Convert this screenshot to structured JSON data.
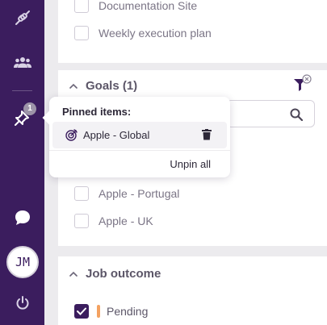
{
  "sidebar": {
    "pinned_count": "1",
    "avatar_initials": "JM",
    "icons": [
      "integrations-icon",
      "team-icon",
      "pin-icon",
      "chat-icon",
      "power-icon"
    ]
  },
  "tasks": {
    "items": [
      {
        "label": "Documentation Site",
        "checked": false
      },
      {
        "label": "Weekly execution plan",
        "checked": false
      }
    ]
  },
  "goals": {
    "title": "Goals (1)",
    "items": [
      {
        "label": "Apple - Portugal",
        "checked": false
      },
      {
        "label": "Apple - UK",
        "checked": false
      }
    ]
  },
  "popover": {
    "title": "Pinned items:",
    "pinned": [
      {
        "label": "Apple - Global"
      }
    ],
    "unpin_all": "Unpin all"
  },
  "job_outcome": {
    "title": "Job outcome",
    "items": [
      {
        "label": "Pending",
        "checked": true,
        "color": "#f4a261"
      }
    ]
  },
  "colors": {
    "sidebar": "#3b1d5e",
    "accent_orange": "#f4a261"
  }
}
